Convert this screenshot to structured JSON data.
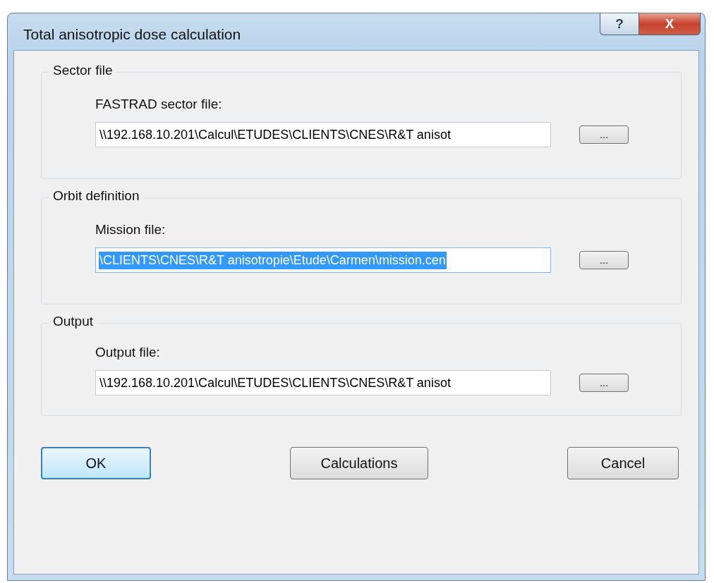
{
  "window": {
    "title": "Total anisotropic dose calculation",
    "controls": [
      {
        "kind": "help",
        "label": "?"
      },
      {
        "kind": "close",
        "label": "X"
      }
    ]
  },
  "groups": [
    {
      "title": "Sector file",
      "label": "FASTRAD sector file:",
      "value": "\\\\192.168.10.201\\Calcul\\ETUDES\\CLIENTS\\CNES\\R&T anisot",
      "focused": false,
      "browse": "..."
    },
    {
      "title": "Orbit definition",
      "label": "Mission file:",
      "value": "\\CLIENTS\\CNES\\R&T anisotropie\\Etude\\Carmen\\mission.cen",
      "focused": true,
      "browse": "..."
    },
    {
      "title": "Output",
      "label": "Output file:",
      "value": "\\\\192.168.10.201\\Calcul\\ETUDES\\CLIENTS\\CNES\\R&T anisot",
      "focused": false,
      "browse": "..."
    }
  ],
  "buttons": [
    {
      "label": "OK",
      "default": true
    },
    {
      "label": "Calculations",
      "default": false
    },
    {
      "label": "Cancel",
      "default": false
    }
  ]
}
